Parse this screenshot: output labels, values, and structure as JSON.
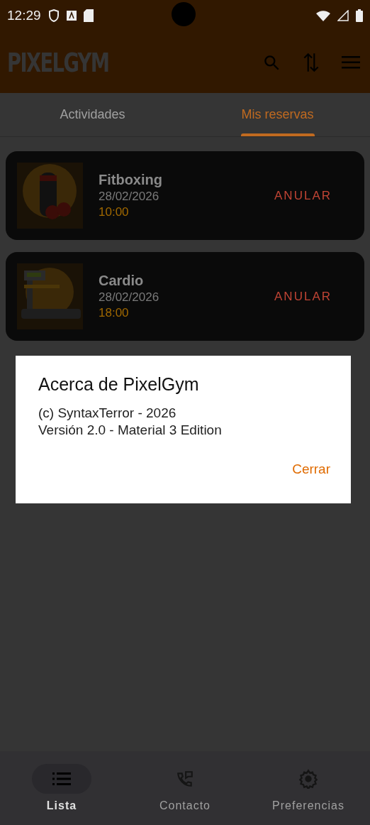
{
  "status_bar": {
    "time": "12:29"
  },
  "app_bar": {
    "title": "PIXELGYM"
  },
  "tabs": [
    {
      "label": "Actividades",
      "selected": false
    },
    {
      "label": "Mis reservas",
      "selected": true
    }
  ],
  "reservations": [
    {
      "name": "Fitboxing",
      "date": "28/02/2026",
      "time": "10:00",
      "action": "ANULAR",
      "kind": "bag"
    },
    {
      "name": "Cardio",
      "date": "28/02/2026",
      "time": "18:00",
      "action": "ANULAR",
      "kind": "treadmill"
    }
  ],
  "dialog": {
    "title": "Acerca de PixelGym",
    "lines": [
      "(c) SyntaxTerror - 2026",
      "Versión 2.0 - Material 3 Edition"
    ],
    "button": "Cerrar"
  },
  "bottom_nav": [
    {
      "label": "Lista",
      "kind": "list",
      "selected": true
    },
    {
      "label": "Contacto",
      "kind": "phone",
      "selected": false
    },
    {
      "label": "Preferencias",
      "kind": "gear",
      "selected": false
    }
  ]
}
